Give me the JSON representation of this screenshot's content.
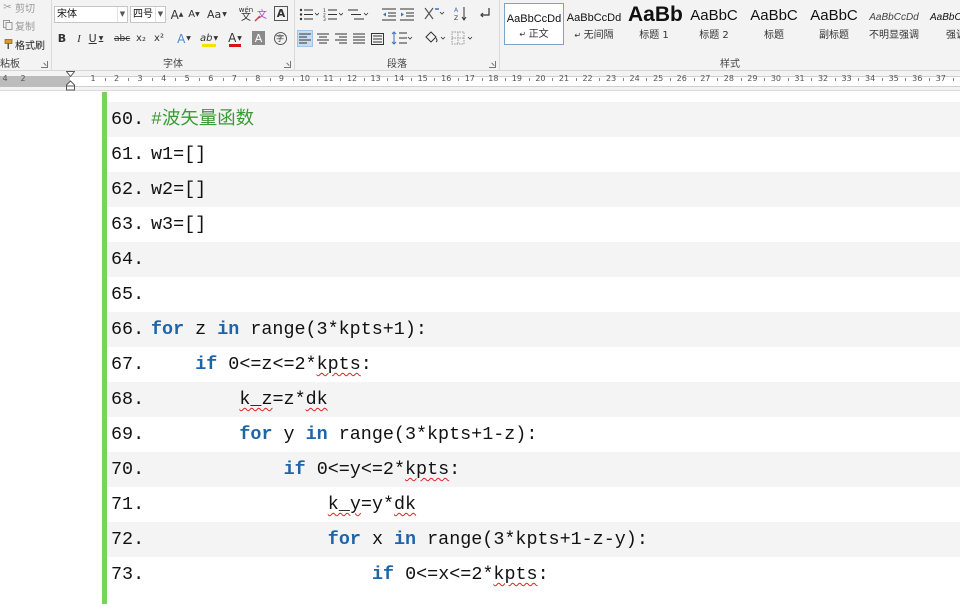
{
  "clipboard": {
    "cut": "剪切",
    "copy": "复制",
    "format_painter": "格式刷",
    "label": "粘板"
  },
  "font": {
    "name": "宋体",
    "size": "四号",
    "label": "字体",
    "grow": "A",
    "shrink": "A",
    "case": "Aa",
    "phonetic": "wén",
    "bold": "B",
    "italic": "I",
    "underline": "U",
    "strike": "abc",
    "subscript": "x₂",
    "superscript": "x²",
    "text_effect": "A",
    "highlight": "ab",
    "font_color": "A",
    "char_shading": "A",
    "enclose": "字",
    "highlight_color": "#f5e200",
    "font_color_value": "#e01010"
  },
  "paragraph": {
    "label": "段落"
  },
  "styles": {
    "label": "样式",
    "items": [
      {
        "preview": "AaBbCcDd",
        "name": "正文"
      },
      {
        "preview": "AaBbCcDd",
        "name": "无间隔"
      },
      {
        "preview": "AaBb",
        "name": "标题 1"
      },
      {
        "preview": "AaBbC",
        "name": "标题 2"
      },
      {
        "preview": "AaBbC",
        "name": "标题"
      },
      {
        "preview": "AaBbC",
        "name": "副标题"
      },
      {
        "preview": "AaBbCcDd",
        "name": "不明显强调"
      },
      {
        "preview": "AaBbCcDd",
        "name": "强调"
      }
    ]
  },
  "ruler": {
    "left_numbers": [
      "4",
      "2"
    ],
    "numbers": [
      "1",
      "2",
      "3",
      "4",
      "5",
      "6",
      "7",
      "8",
      "9",
      "10",
      "11",
      "12",
      "13",
      "14",
      "15",
      "16",
      "17",
      "18",
      "19",
      "20",
      "21",
      "22",
      "23",
      "24",
      "25",
      "26",
      "27",
      "28",
      "29",
      "30",
      "31",
      "32",
      "33",
      "34",
      "35",
      "36",
      "37"
    ]
  },
  "code_lines": [
    {
      "num": "60.",
      "indent": 0,
      "tokens": [
        {
          "t": "#波矢量函数",
          "c": "cm"
        }
      ]
    },
    {
      "num": "61.",
      "indent": 0,
      "tokens": [
        {
          "t": "w1=[]",
          "c": ""
        }
      ]
    },
    {
      "num": "62.",
      "indent": 0,
      "tokens": [
        {
          "t": "w2=[]",
          "c": ""
        }
      ]
    },
    {
      "num": "63.",
      "indent": 0,
      "tokens": [
        {
          "t": "w3=[]",
          "c": ""
        }
      ]
    },
    {
      "num": "64.",
      "indent": 0,
      "tokens": []
    },
    {
      "num": "65.",
      "indent": 0,
      "tokens": []
    },
    {
      "num": "66.",
      "indent": 0,
      "tokens": [
        {
          "t": "for",
          "c": "kw"
        },
        {
          "t": " z ",
          "c": ""
        },
        {
          "t": "in",
          "c": "kw"
        },
        {
          "t": " range(3*kpts+1):",
          "c": ""
        }
      ]
    },
    {
      "num": "67.",
      "indent": 4,
      "tokens": [
        {
          "t": "if",
          "c": "kw"
        },
        {
          "t": " 0<=z<=2*",
          "c": ""
        },
        {
          "t": "kpts",
          "c": "sq"
        },
        {
          "t": ":",
          "c": ""
        }
      ]
    },
    {
      "num": "68.",
      "indent": 8,
      "tokens": [
        {
          "t": "k_z",
          "c": "sq"
        },
        {
          "t": "=z*",
          "c": ""
        },
        {
          "t": "dk",
          "c": "sq"
        }
      ]
    },
    {
      "num": "69.",
      "indent": 8,
      "tokens": [
        {
          "t": "for",
          "c": "kw"
        },
        {
          "t": " y ",
          "c": ""
        },
        {
          "t": "in",
          "c": "kw"
        },
        {
          "t": " range(3*kpts+1-z):",
          "c": ""
        }
      ]
    },
    {
      "num": "70.",
      "indent": 12,
      "tokens": [
        {
          "t": "if",
          "c": "kw"
        },
        {
          "t": " 0<=y<=2*",
          "c": ""
        },
        {
          "t": "kpts",
          "c": "sq"
        },
        {
          "t": ":",
          "c": ""
        }
      ]
    },
    {
      "num": "71.",
      "indent": 16,
      "tokens": [
        {
          "t": "k_y",
          "c": "sq"
        },
        {
          "t": "=y*",
          "c": ""
        },
        {
          "t": "dk",
          "c": "sq"
        }
      ]
    },
    {
      "num": "72.",
      "indent": 16,
      "tokens": [
        {
          "t": "for",
          "c": "kw"
        },
        {
          "t": " x ",
          "c": ""
        },
        {
          "t": "in",
          "c": "kw"
        },
        {
          "t": " range(3*kpts+1-z-y):",
          "c": ""
        }
      ]
    },
    {
      "num": "73.",
      "indent": 20,
      "tokens": [
        {
          "t": "if",
          "c": "kw"
        },
        {
          "t": " 0<=x<=2*",
          "c": ""
        },
        {
          "t": "kpts",
          "c": "sq"
        },
        {
          "t": ":",
          "c": ""
        }
      ]
    }
  ],
  "colors": {
    "keyword": "#1f64a8",
    "comment": "#3a9a34",
    "change_bar": "#79d35a",
    "spell_squiggle": "#e02020"
  }
}
